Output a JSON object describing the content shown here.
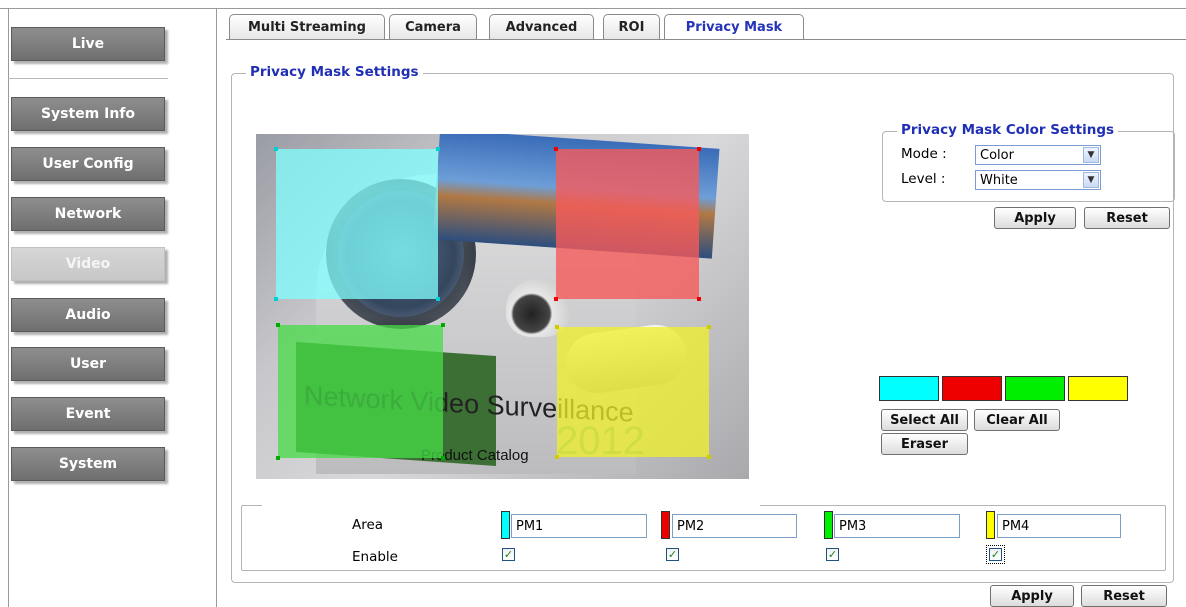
{
  "sidebar": {
    "live": "Live",
    "items": [
      "System Info",
      "User Config",
      "Network",
      "Video",
      "Audio",
      "User",
      "Event",
      "System"
    ],
    "active": "Video"
  },
  "tabs": [
    "Multi Streaming",
    "Camera",
    "Advanced",
    "ROI",
    "Privacy Mask"
  ],
  "active_tab": "Privacy Mask",
  "settings": {
    "legend": "Privacy Mask Settings",
    "color_settings": {
      "legend": "Privacy Mask Color Settings",
      "mode_label": "Mode :",
      "mode_value": "Color",
      "level_label": "Level :",
      "level_value": "White",
      "apply": "Apply",
      "reset": "Reset"
    },
    "palette": [
      "#00ffff",
      "#ee0000",
      "#00ee00",
      "#ffff00"
    ],
    "select_all": "Select All",
    "clear_all": "Clear All",
    "eraser": "Eraser",
    "areas": {
      "area_label": "Area",
      "enable_label": "Enable",
      "items": [
        {
          "name": "PM1",
          "color": "#00ffff",
          "enabled": true
        },
        {
          "name": "PM2",
          "color": "#ee0000",
          "enabled": true
        },
        {
          "name": "PM3",
          "color": "#00ee00",
          "enabled": true
        },
        {
          "name": "PM4",
          "color": "#ffff00",
          "enabled": true
        }
      ]
    },
    "apply": "Apply",
    "reset": "Reset"
  },
  "preview": {
    "banner_text": "Network Video Surveillance",
    "subtitle": "Product Catalog",
    "year": "2012"
  }
}
